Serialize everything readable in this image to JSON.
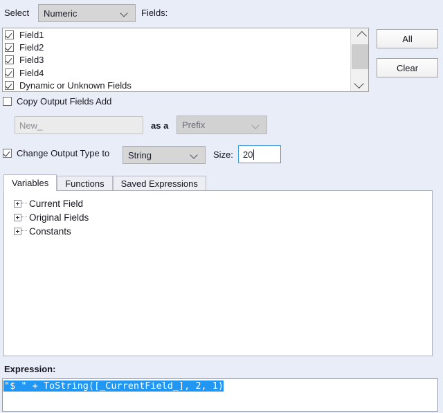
{
  "header": {
    "select_label": "Select",
    "type_filter_value": "Numeric",
    "fields_label": "Fields:"
  },
  "fields_list": {
    "items": [
      {
        "label": "Field1",
        "checked": true
      },
      {
        "label": "Field2",
        "checked": true
      },
      {
        "label": "Field3",
        "checked": true
      },
      {
        "label": "Field4",
        "checked": true
      },
      {
        "label": "Dynamic or Unknown Fields",
        "checked": true
      }
    ],
    "scrollbar": {
      "up_icon": "chevron-up-icon",
      "down_icon": "chevron-down-icon"
    }
  },
  "buttons": {
    "all_label": "All",
    "clear_label": "Clear"
  },
  "copy_output": {
    "checkbox_label": "Copy Output Fields Add",
    "checked": false,
    "name_placeholder": "New_",
    "name_value": "",
    "as_a_label": "as a",
    "affix_value": "Prefix",
    "disabled": true
  },
  "change_output_type": {
    "checkbox_label": "Change Output Type to",
    "checked": true,
    "type_value": "String",
    "size_label": "Size:",
    "size_value": "20"
  },
  "tabs": [
    {
      "label": "Variables",
      "active": true
    },
    {
      "label": "Functions",
      "active": false
    },
    {
      "label": "Saved Expressions",
      "active": false
    }
  ],
  "tree": {
    "nodes": [
      {
        "label": "Current Field",
        "expander": "plus-icon"
      },
      {
        "label": "Original Fields",
        "expander": "plus-icon"
      },
      {
        "label": "Constants",
        "expander": "plus-icon"
      }
    ]
  },
  "expression": {
    "label": "Expression:",
    "text": "\"$ \" + ToString([_CurrentField_], 2, 1)",
    "selected": true
  },
  "colors": {
    "background": "#e9edf7",
    "selection": "#2196f3",
    "focus_border": "#3b9ade",
    "panel": "#ffffff"
  }
}
